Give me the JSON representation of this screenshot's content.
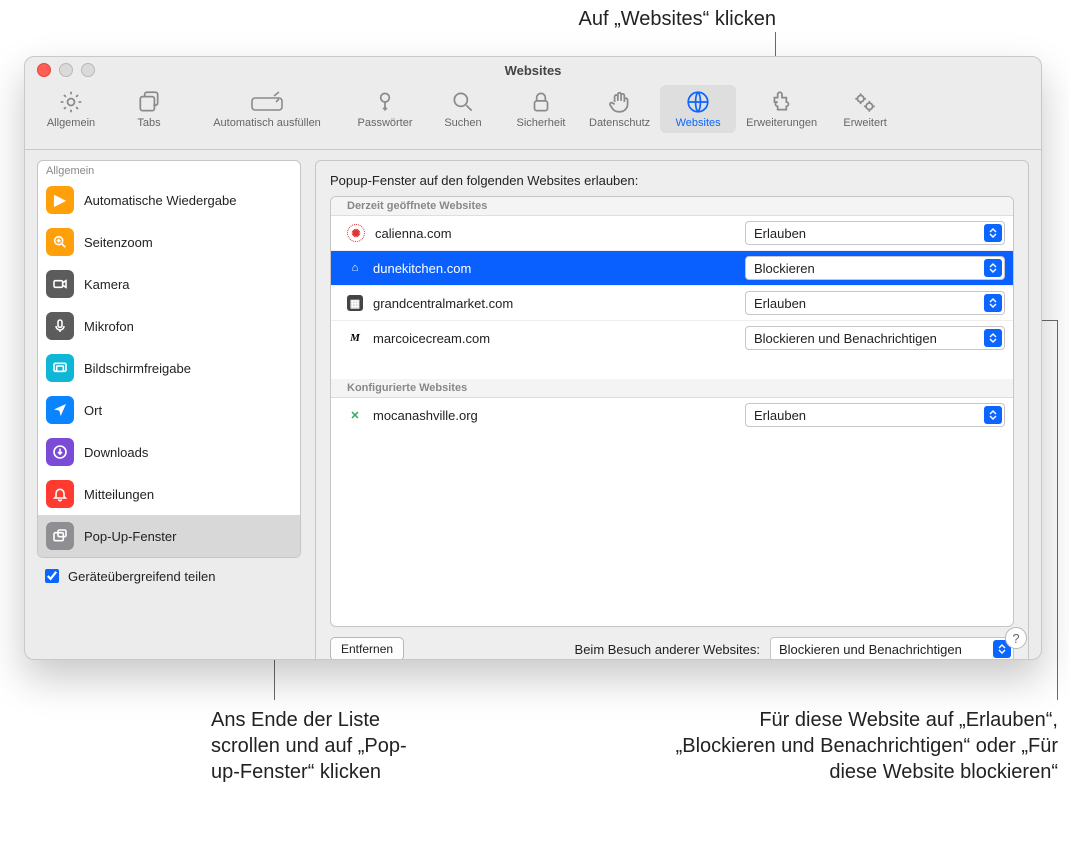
{
  "callouts": {
    "top": "Auf „Websites“ klicken",
    "bottom_left": "Ans Ende der Liste scrollen und auf „Pop-up-Fenster“ klicken",
    "bottom_right": "Für diese Website auf „Erlauben“, „Blockieren und Benachrichtigen“ oder „Für diese Website blockieren“"
  },
  "window": {
    "title": "Websites"
  },
  "toolbar": {
    "allgemein": "Allgemein",
    "tabs": "Tabs",
    "autofill": "Automatisch ausfüllen",
    "passwoerter": "Passwörter",
    "suchen": "Suchen",
    "sicherheit": "Sicherheit",
    "datenschutz": "Datenschutz",
    "websites": "Websites",
    "erweiterungen": "Erweiterungen",
    "erweitert": "Erweitert"
  },
  "sidebar": {
    "header": "Allgemein",
    "items": {
      "auto_wiedergabe": "Automatische Wiedergabe",
      "seitenzoom": "Seitenzoom",
      "kamera": "Kamera",
      "mikrofon": "Mikrofon",
      "bildschirmfreigabe": "Bildschirmfreigabe",
      "ort": "Ort",
      "downloads": "Downloads",
      "mitteilungen": "Mitteilungen",
      "popup": "Pop-Up-Fenster"
    },
    "share": "Geräteübergreifend teilen"
  },
  "main": {
    "title": "Popup-Fenster auf den folgenden Websites erlauben:",
    "section_open": "Derzeit geöffnete Websites",
    "section_conf": "Konfigurierte Websites",
    "sites": {
      "calienna": {
        "domain": "calienna.com",
        "value": "Erlauben"
      },
      "dune": {
        "domain": "dunekitchen.com",
        "value": "Blockieren"
      },
      "grand": {
        "domain": "grandcentralmarket.com",
        "value": "Erlauben"
      },
      "marco": {
        "domain": "marcoicecream.com",
        "value": "Blockieren und Benachrichtigen"
      },
      "moca": {
        "domain": "mocanashville.org",
        "value": "Erlauben"
      }
    },
    "remove": "Entfernen",
    "other_label": "Beim Besuch anderer Websites:",
    "other_value": "Blockieren und Benachrichtigen"
  },
  "help": "?"
}
